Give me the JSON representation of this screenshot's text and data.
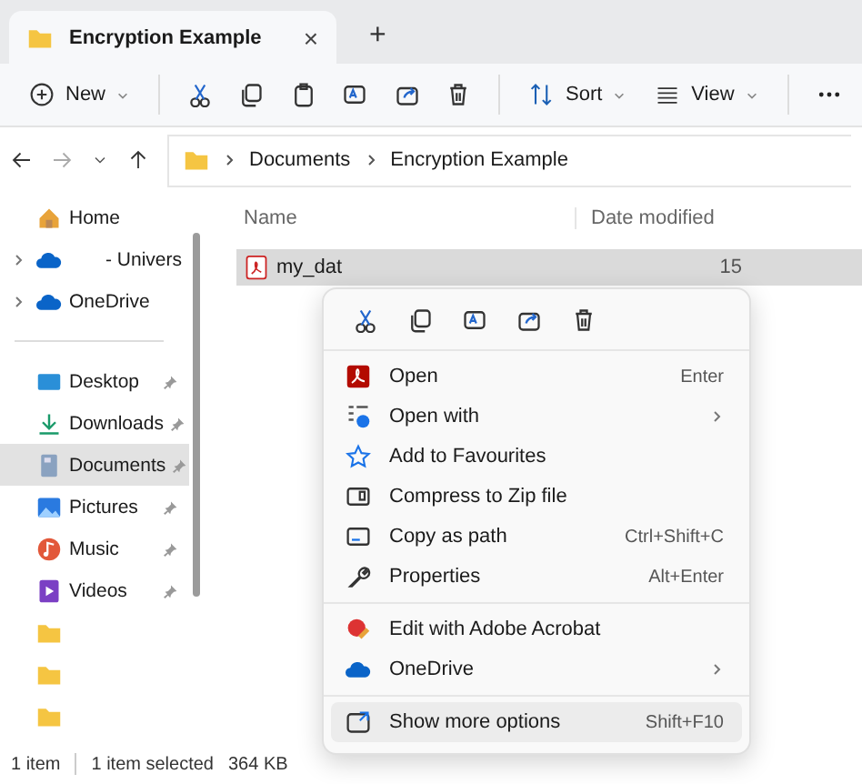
{
  "tab": {
    "title": "Encryption Example",
    "close": "×",
    "new_tab": "+"
  },
  "toolbar": {
    "new": "New",
    "sort": "Sort",
    "view": "View"
  },
  "address": {
    "crumbs": [
      "Documents",
      "Encryption Example"
    ]
  },
  "sidebar": {
    "items": [
      {
        "label": "Home",
        "expandable": false,
        "pinned": false,
        "selected": false
      },
      {
        "label": "- Univers",
        "expandable": true,
        "pinned": false,
        "selected": false
      },
      {
        "label": "OneDrive",
        "expandable": true,
        "pinned": false,
        "selected": false
      },
      {
        "kind": "divider"
      },
      {
        "label": "Desktop",
        "expandable": false,
        "pinned": true,
        "selected": false
      },
      {
        "label": "Downloads",
        "expandable": false,
        "pinned": true,
        "selected": false
      },
      {
        "label": "Documents",
        "expandable": false,
        "pinned": true,
        "selected": true
      },
      {
        "label": "Pictures",
        "expandable": false,
        "pinned": true,
        "selected": false
      },
      {
        "label": "Music",
        "expandable": false,
        "pinned": true,
        "selected": false
      },
      {
        "label": "Videos",
        "expandable": false,
        "pinned": true,
        "selected": false
      },
      {
        "expandable": false,
        "pinned": false,
        "selected": false
      },
      {
        "expandable": false,
        "pinned": false,
        "selected": false
      },
      {
        "expandable": false,
        "pinned": false,
        "selected": false
      }
    ]
  },
  "table": {
    "columns": [
      "Name",
      "Date modified"
    ],
    "rows": [
      {
        "name": "my_dat",
        "date": "15",
        "selected": true
      }
    ]
  },
  "context_menu": {
    "groups": [
      [
        {
          "label": "Open",
          "shortcut": "Enter",
          "submenu": false,
          "selected": false
        },
        {
          "label": "Open with",
          "submenu": true,
          "selected": false
        },
        {
          "label": "Add to Favourites",
          "submenu": false,
          "selected": false
        },
        {
          "label": "Compress to Zip file",
          "submenu": false,
          "selected": false
        },
        {
          "label": "Copy as path",
          "shortcut": "Ctrl+Shift+C",
          "submenu": false,
          "selected": false
        },
        {
          "label": "Properties",
          "shortcut": "Alt+Enter",
          "submenu": false,
          "selected": false
        }
      ],
      [
        {
          "label": "Edit with Adobe Acrobat",
          "submenu": false,
          "selected": false
        },
        {
          "label": "OneDrive",
          "submenu": true,
          "selected": false
        }
      ],
      [
        {
          "label": "Show more options",
          "shortcut": "Shift+F10",
          "submenu": false,
          "selected": true
        }
      ]
    ]
  },
  "status_bar": {
    "count": "1 item",
    "selection": "1 item selected",
    "size": "364 KB"
  }
}
